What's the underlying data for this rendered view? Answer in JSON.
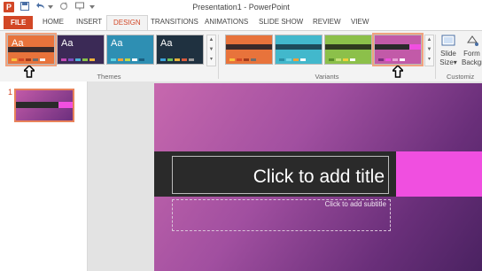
{
  "window": {
    "title": "Presentation1 - PowerPoint"
  },
  "quick_access": {
    "logo": "P",
    "save_icon": "save-icon",
    "undo_icon": "undo-icon",
    "redo_icon": "redo-icon",
    "present_icon": "present-icon"
  },
  "tabs": [
    {
      "label": "FILE"
    },
    {
      "label": "HOME"
    },
    {
      "label": "INSERT"
    },
    {
      "label": "DESIGN"
    },
    {
      "label": "TRANSITIONS"
    },
    {
      "label": "ANIMATIONS"
    },
    {
      "label": "SLIDE SHOW"
    },
    {
      "label": "REVIEW"
    },
    {
      "label": "VIEW"
    }
  ],
  "ribbon": {
    "themes_label": "Themes",
    "variants_label": "Variants",
    "customize_label": "Customiz",
    "slide_size_line1": "Slide",
    "slide_size_line2": "Size",
    "format_bg_line1": "Form",
    "format_bg_line2": "Backgr",
    "theme_aa": "Aa",
    "colors": {
      "accent": "#d24726",
      "selected_outline": "#f0a37f"
    }
  },
  "slides_pane": {
    "slide_number": "1"
  },
  "slide": {
    "title_placeholder": "Click to add title",
    "subtitle_placeholder": "Click to add subtitle"
  }
}
